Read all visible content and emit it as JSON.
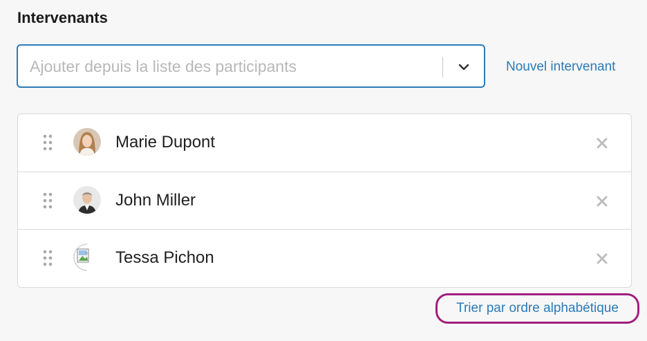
{
  "section": {
    "title": "Intervenants"
  },
  "participant_select": {
    "placeholder": "Ajouter depuis la liste des participants"
  },
  "new_speaker_link": "Nouvel intervenant",
  "speakers": [
    {
      "name": "Marie Dupont",
      "avatar": "photo-woman"
    },
    {
      "name": "John Miller",
      "avatar": "photo-man"
    },
    {
      "name": "Tessa Pichon",
      "avatar": "broken-image"
    }
  ],
  "sort_link": "Trier par ordre alphabétique",
  "colors": {
    "accent": "#2a7ab8",
    "highlight": "#a01f7e"
  }
}
